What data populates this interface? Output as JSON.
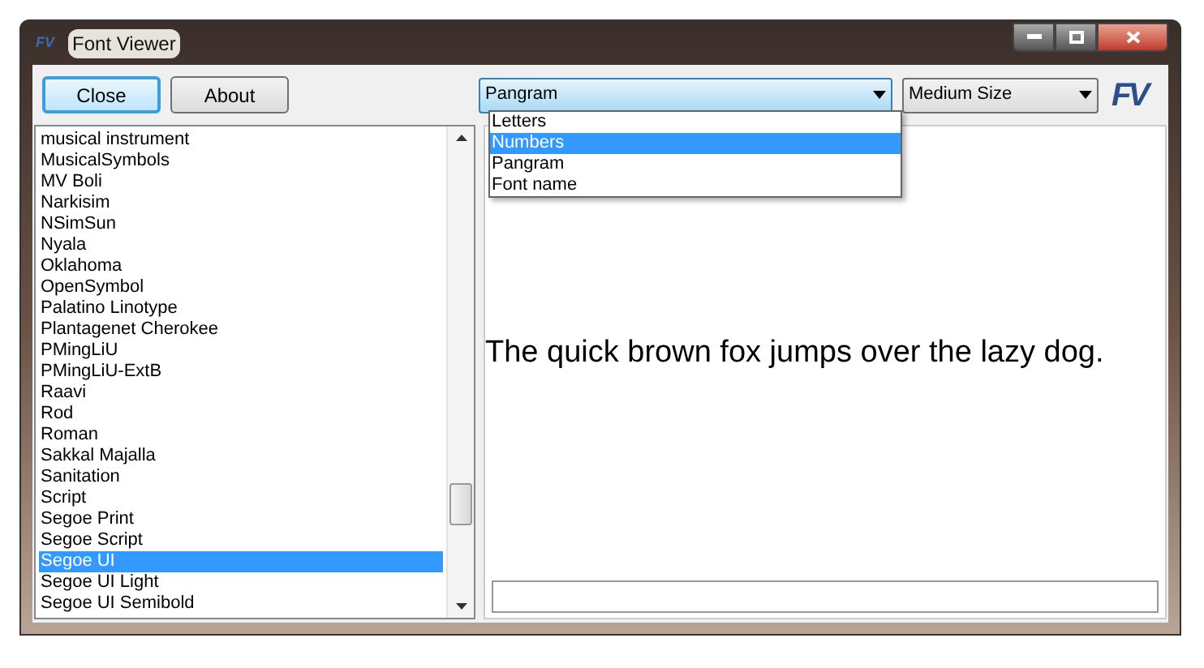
{
  "window": {
    "title": "Font Viewer",
    "icon_text": "FV"
  },
  "toolbar": {
    "buttons": [
      {
        "label": "Close",
        "focused": true
      },
      {
        "label": "About",
        "focused": false
      }
    ],
    "mode_select": {
      "value": "Pangram",
      "expanded": true,
      "options": [
        {
          "label": "Letters",
          "highlighted": false
        },
        {
          "label": "Numbers",
          "highlighted": true
        },
        {
          "label": "Pangram",
          "highlighted": false
        },
        {
          "label": "Font name",
          "highlighted": false
        }
      ]
    },
    "size_select": {
      "value": "Medium Size"
    },
    "logo": "FV"
  },
  "font_list": {
    "items": [
      {
        "label": "musical instrument",
        "selected": false
      },
      {
        "label": "MusicalSymbols",
        "selected": false
      },
      {
        "label": "MV Boli",
        "selected": false
      },
      {
        "label": "Narkisim",
        "selected": false
      },
      {
        "label": "NSimSun",
        "selected": false
      },
      {
        "label": "Nyala",
        "selected": false
      },
      {
        "label": "Oklahoma",
        "selected": false
      },
      {
        "label": "OpenSymbol",
        "selected": false
      },
      {
        "label": "Palatino Linotype",
        "selected": false
      },
      {
        "label": "Plantagenet Cherokee",
        "selected": false
      },
      {
        "label": "PMingLiU",
        "selected": false
      },
      {
        "label": "PMingLiU-ExtB",
        "selected": false
      },
      {
        "label": "Raavi",
        "selected": false
      },
      {
        "label": "Rod",
        "selected": false
      },
      {
        "label": "Roman",
        "selected": false
      },
      {
        "label": "Sakkal Majalla",
        "selected": false
      },
      {
        "label": "Sanitation",
        "selected": false
      },
      {
        "label": "Script",
        "selected": false
      },
      {
        "label": "Segoe Print",
        "selected": false
      },
      {
        "label": "Segoe Script",
        "selected": false
      },
      {
        "label": "Segoe UI",
        "selected": true
      },
      {
        "label": "Segoe UI Light",
        "selected": false
      },
      {
        "label": "Segoe UI Semibold",
        "selected": false
      }
    ]
  },
  "preview": {
    "text": "The quick brown fox jumps over the lazy dog."
  }
}
